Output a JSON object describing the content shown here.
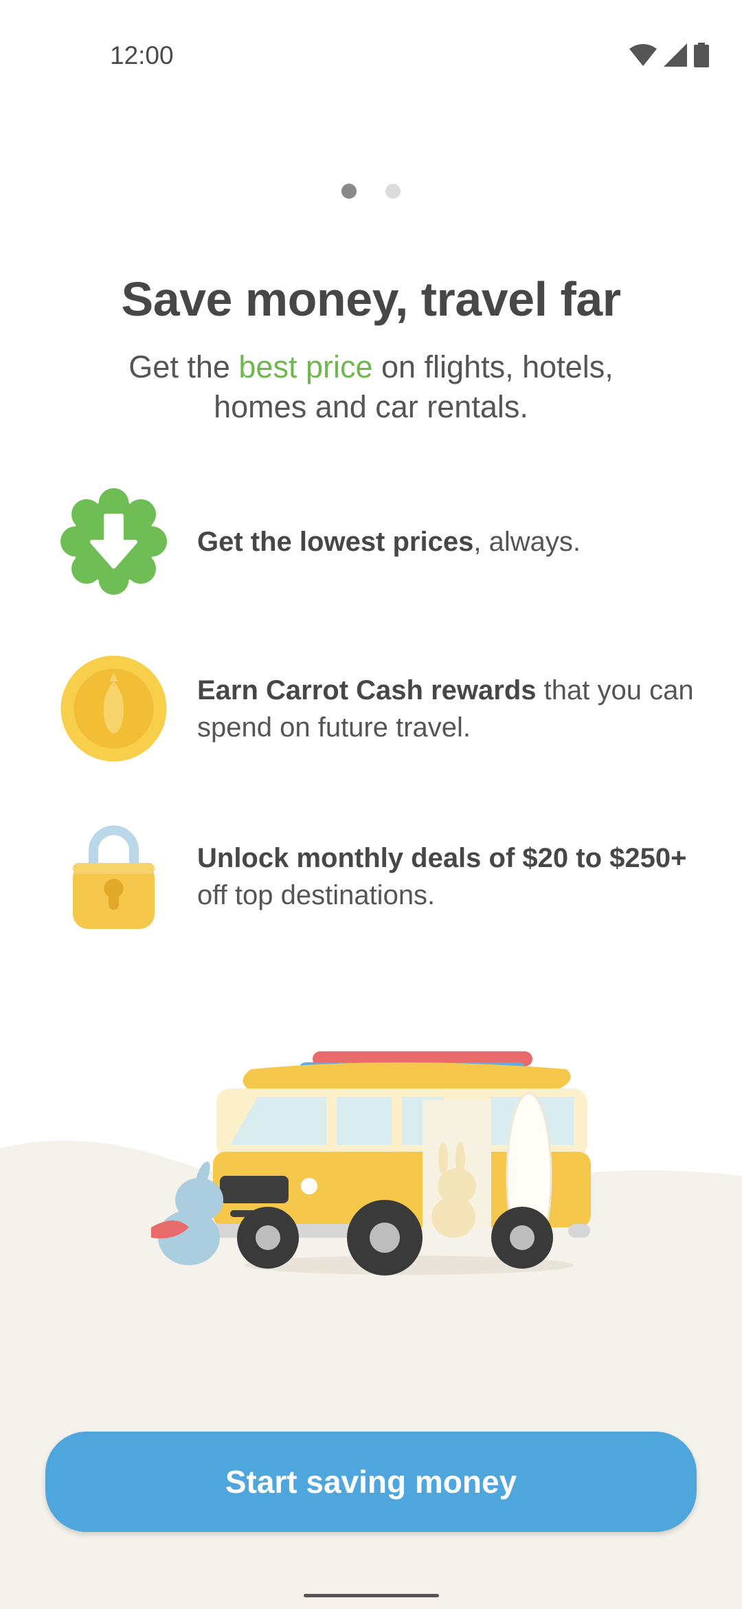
{
  "status_bar": {
    "time": "12:00",
    "icons": [
      "wifi-icon",
      "cell-signal-icon",
      "battery-icon"
    ]
  },
  "pager": {
    "page_count": 2,
    "current_page": 1
  },
  "headline": "Save money, travel far",
  "subhead": {
    "prefix": "Get the ",
    "highlight": "best price",
    "suffix": " on flights, hotels, homes and car rentals."
  },
  "features": [
    {
      "icon": "down-arrow-badge-icon",
      "bold": "Get the lowest prices",
      "highlight": "",
      "rest": ", always."
    },
    {
      "icon": "carrot-coin-icon",
      "bold": "Earn Carrot Cash rewards",
      "highlight": "",
      "rest": " that you can spend on future travel."
    },
    {
      "icon": "padlock-icon",
      "bold": "Unlock monthly deals of ",
      "highlight": "$20 to $250+",
      "rest": " off top destinations."
    }
  ],
  "illustration": "camper-van-bunnies-illustration",
  "cta_label": "Start saving money",
  "colors": {
    "accent_green": "#6fb84f",
    "button_blue": "#4ea6dd",
    "text_dark": "#474747",
    "sand": "#f5f2ec"
  }
}
